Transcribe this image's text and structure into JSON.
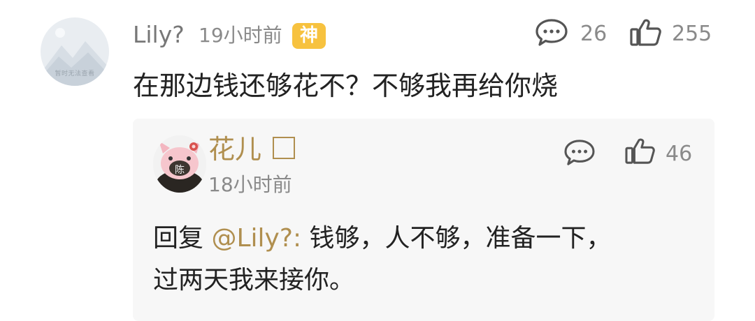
{
  "comment": {
    "username": "Lily?",
    "timestamp": "19小时前",
    "badge": "神",
    "reply_count": "26",
    "like_count": "255",
    "text": "在那边钱还够花不？不够我再给你烧",
    "avatar_placeholder": "暂时无法查看"
  },
  "reply": {
    "username": "花儿",
    "timestamp": "18小时前",
    "like_count": "46",
    "prefix": "回复",
    "mention": "@Lily?:",
    "text_line1": "钱够，人不够，准备一下，",
    "text_line2": "过两天我来接你。"
  },
  "colors": {
    "gold": "#b08f4f",
    "badge": "#f7c23f",
    "meta_text": "#8a8a8a",
    "reply_bg": "#f7f7f7"
  },
  "icons": [
    "comment-icon",
    "thumbs-up-icon",
    "square-icon",
    "avatar-placeholder-icon"
  ]
}
